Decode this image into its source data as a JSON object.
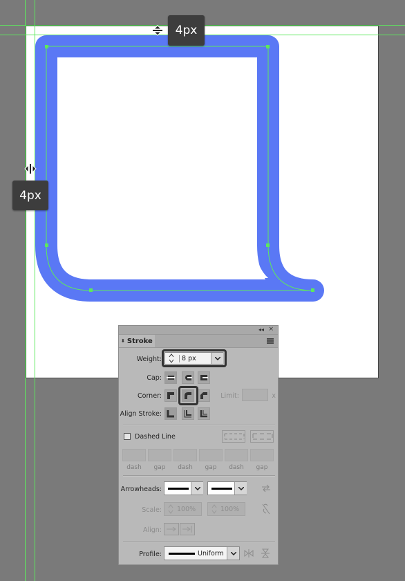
{
  "canvas": {
    "top_tooltip": "4px",
    "left_tooltip": "4px",
    "stroke_color": "#5a78f5",
    "path_color": "#5de85d"
  },
  "panel": {
    "title": "Stroke",
    "weight_label": "Weight:",
    "weight_value": "8 px",
    "cap_label": "Cap:",
    "corner_label": "Corner:",
    "limit_label": "Limit:",
    "limit_unit": "x",
    "align_stroke_label": "Align Stroke:",
    "dashed_line_label": "Dashed Line",
    "dash_labels": [
      "dash",
      "gap",
      "dash",
      "gap",
      "dash",
      "gap"
    ],
    "arrowheads_label": "Arrowheads:",
    "scale_label": "Scale:",
    "scale_start": "100%",
    "scale_end": "100%",
    "align_label": "Align:",
    "profile_label": "Profile:",
    "profile_value": "Uniform"
  }
}
